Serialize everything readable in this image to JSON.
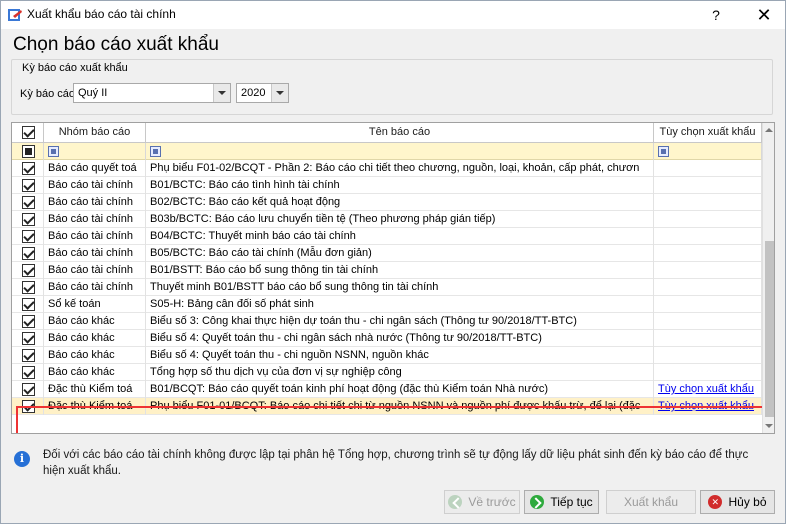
{
  "window": {
    "title": "Xuất khẩu báo cáo tài chính",
    "help_label": "?",
    "close_label": "✕"
  },
  "heading": "Chọn báo cáo xuất khẩu",
  "period": {
    "group_label": "Kỳ báo cáo xuất khẩu",
    "field_label": "Kỳ báo cáo",
    "quarter_value": "Quý II",
    "year_value": "2020"
  },
  "grid": {
    "columns": {
      "group": "Nhóm báo cáo",
      "name": "Tên báo cáo",
      "option": "Tùy chọn xuất khẩu"
    },
    "rows": [
      {
        "group": "Báo cáo quyết toá",
        "name": "Phụ biểu F01-02/BCQT - Phần 2: Báo cáo chi tiết theo chương, nguồn, loại, khoản, cấp phát, chươn",
        "option": ""
      },
      {
        "group": "Báo cáo tài chính",
        "name": "B01/BCTC: Báo cáo tình hình tài chính",
        "option": ""
      },
      {
        "group": "Báo cáo tài chính",
        "name": "B02/BCTC: Báo cáo kết quả hoạt động",
        "option": ""
      },
      {
        "group": "Báo cáo tài chính",
        "name": "B03b/BCTC: Báo cáo lưu chuyển tiền tệ (Theo phương pháp gián tiếp)",
        "option": ""
      },
      {
        "group": "Báo cáo tài chính",
        "name": "B04/BCTC: Thuyết minh báo cáo tài chính",
        "option": ""
      },
      {
        "group": "Báo cáo tài chính",
        "name": "B05/BCTC: Báo cáo tài chính (Mẫu đơn giản)",
        "option": ""
      },
      {
        "group": "Báo cáo tài chính",
        "name": "B01/BSTT: Báo cáo bổ sung thông tin tài chính",
        "option": ""
      },
      {
        "group": "Báo cáo tài chính",
        "name": "Thuyết minh B01/BSTT báo cáo bổ sung thông tin tài chính",
        "option": ""
      },
      {
        "group": "Sổ kế toán",
        "name": "S05-H: Bảng cân đối số phát sinh",
        "option": ""
      },
      {
        "group": "Báo cáo khác",
        "name": "Biểu số 3: Công khai thực hiện dự toán thu - chi ngân sách (Thông tư 90/2018/TT-BTC)",
        "option": ""
      },
      {
        "group": "Báo cáo khác",
        "name": "Biểu số 4: Quyết toán thu - chi ngân sách nhà nước (Thông tư 90/2018/TT-BTC)",
        "option": ""
      },
      {
        "group": "Báo cáo khác",
        "name": "Biểu số 4: Quyết toán thu - chi nguồn NSNN, nguồn khác",
        "option": ""
      },
      {
        "group": "Báo cáo khác",
        "name": "Tổng hợp số thu dịch vụ của đơn vị sự nghiệp công",
        "option": ""
      },
      {
        "group": "Đặc thù Kiểm toá",
        "name": "B01/BCQT: Báo cáo quyết toán kinh phí hoạt động (đặc thù Kiểm toán Nhà nước)",
        "option": "Tùy chọn xuất khẩu"
      },
      {
        "group": "Đặc thù Kiểm toá",
        "name": "Phụ biểu F01-01/BCQT: Báo cáo chi tiết chi từ nguồn NSNN và nguồn phí được khấu trừ, để lại (đặc",
        "option": "Tùy chọn xuất khẩu"
      }
    ]
  },
  "note": "Đối với các báo cáo tài chính không được lập tại phân hệ Tổng hợp, chương trình sẽ tự động lấy dữ liệu phát sinh đến kỳ báo cáo để thực hiện xuất khẩu.",
  "buttons": {
    "back": "Về trước",
    "next": "Tiếp tục",
    "export": "Xuất khẩu",
    "cancel": "Hủy bỏ"
  }
}
